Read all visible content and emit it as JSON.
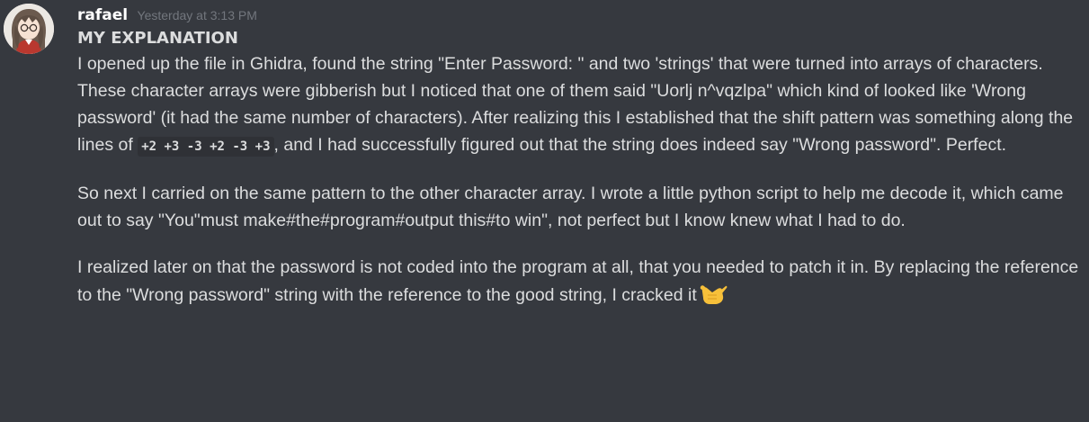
{
  "message": {
    "author": "rafael",
    "timestamp": "Yesterday at 3:13 PM",
    "title": "MY EXPLANATION",
    "paragraph1": {
      "before_code": "I opened up the file in Ghidra, found the string \"Enter Password: \" and two 'strings' that were turned into arrays of characters. These character arrays were gibberish but I noticed that one of them said \"Uorlj n^vqzlpa\" which kind of looked like 'Wrong password' (it had the same number of characters). After realizing this I established that the shift pattern was something along the lines of",
      "code": "+2 +3 -3 +2 -3 +3",
      "after_code": ", and I had successfully figured out that the string does indeed say \"Wrong password\". Perfect."
    },
    "paragraph2": "So next I carried on the same pattern to the other character array. I wrote a little python script to help me decode it, which came out to say \"You\"must make#the#program#output this#to win\", not perfect but I know knew what I had to do.",
    "paragraph3": "I realized later on that the password is not coded into the program at all, that you needed to patch it in. By replacing the reference to the \"Wrong password\" string with the reference to the good string, I cracked it",
    "end_emoji": "call-me-hand-emoji",
    "colors": {
      "background": "#36393f",
      "username": "#ffffff",
      "timestamp": "#72767d",
      "text": "#dcddde",
      "code_background": "#2f3136"
    }
  }
}
